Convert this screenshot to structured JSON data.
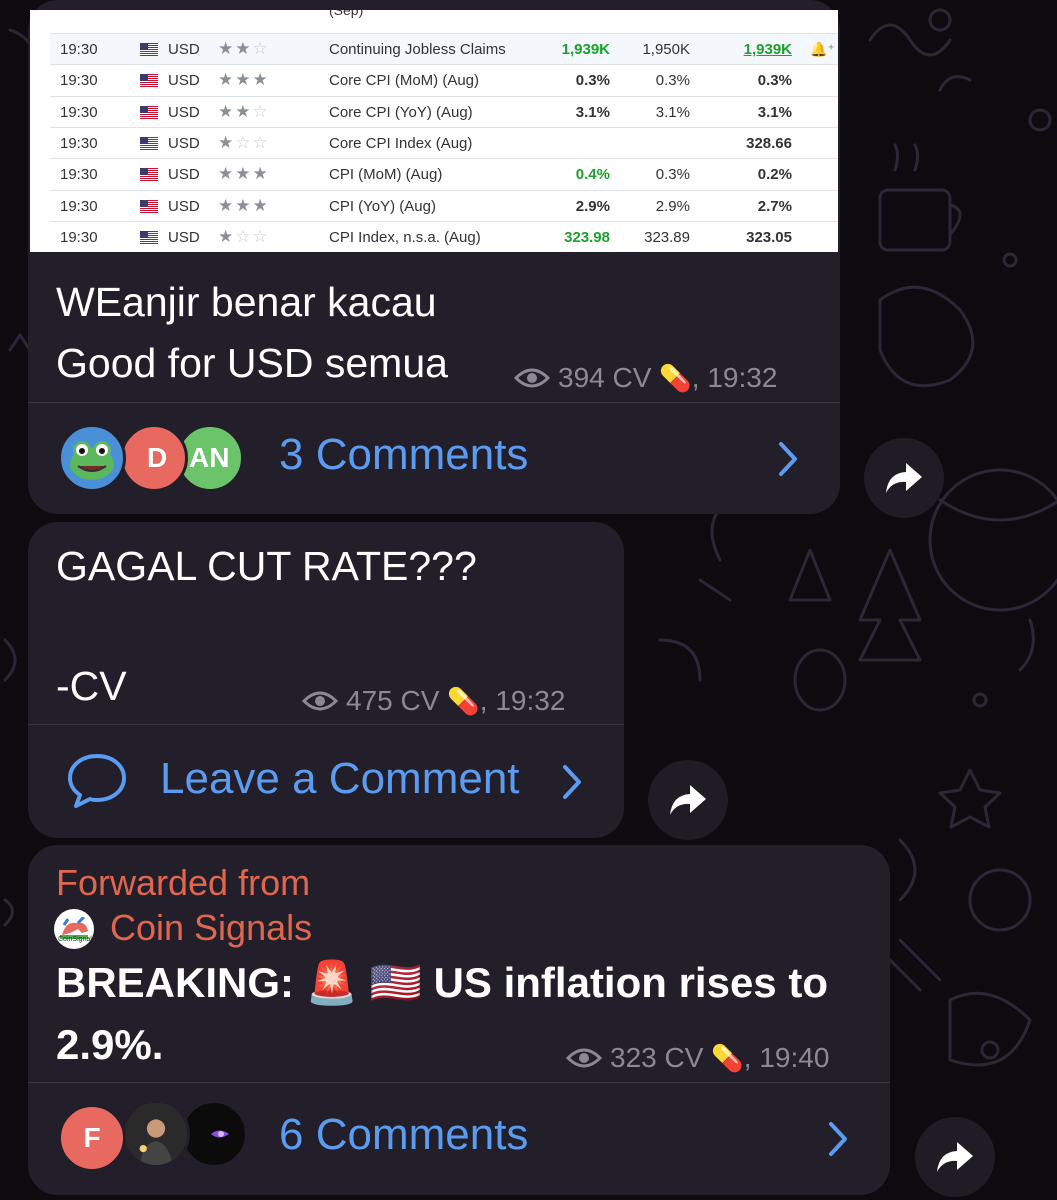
{
  "table": {
    "partial_top_text": "(Sep)",
    "rows": [
      {
        "time": "19:30",
        "currency": "USD",
        "stars": 2,
        "event": "Continuing Jobless Claims",
        "actual": "1,939K",
        "actual_color": "green",
        "forecast": "1,950K",
        "previous": "1,939K",
        "previous_color": "green",
        "highlight": true,
        "bell": "🔔⁺"
      },
      {
        "time": "19:30",
        "currency": "USD",
        "stars": 3,
        "event": "Core CPI (MoM) (Aug)",
        "actual": "0.3%",
        "actual_color": "black",
        "forecast": "0.3%",
        "previous": "0.3%",
        "previous_color": "black"
      },
      {
        "time": "19:30",
        "currency": "USD",
        "stars": 2,
        "event": "Core CPI (YoY) (Aug)",
        "actual": "3.1%",
        "actual_color": "black",
        "forecast": "3.1%",
        "previous": "3.1%",
        "previous_color": "black"
      },
      {
        "time": "19:30",
        "currency": "USD",
        "stars": 1,
        "event": "Core CPI Index (Aug)",
        "actual": "",
        "actual_color": "black",
        "forecast": "",
        "previous": "328.66",
        "previous_color": "black"
      },
      {
        "time": "19:30",
        "currency": "USD",
        "stars": 3,
        "event": "CPI (MoM) (Aug)",
        "actual": "0.4%",
        "actual_color": "green",
        "forecast": "0.3%",
        "previous": "0.2%",
        "previous_color": "black"
      },
      {
        "time": "19:30",
        "currency": "USD",
        "stars": 3,
        "event": "CPI (YoY) (Aug)",
        "actual": "2.9%",
        "actual_color": "black",
        "forecast": "2.9%",
        "previous": "2.7%",
        "previous_color": "black"
      },
      {
        "time": "19:30",
        "currency": "USD",
        "stars": 1,
        "event": "CPI Index, n.s.a. (Aug)",
        "actual": "323.98",
        "actual_color": "green",
        "forecast": "323.89",
        "previous": "323.05",
        "previous_color": "black"
      }
    ]
  },
  "messages": [
    {
      "line1": "WEanjir benar kacau",
      "line2": "Good for USD semua",
      "views": "394 CV",
      "pill": "💊",
      "time": ", 19:32",
      "comments_label": "3 Comments",
      "avatars": [
        {
          "initial": "",
          "color": "#4a90d9",
          "icon": "frog-icon"
        },
        {
          "initial": "D",
          "color": "#e8695f"
        },
        {
          "initial": "AN",
          "color": "#6bc46a"
        }
      ]
    },
    {
      "line1": "GAGAL CUT RATE???",
      "line2": "-CV",
      "views": "475 CV",
      "pill": "💊",
      "time": ", 19:32",
      "comments_label": "Leave a Comment"
    },
    {
      "forwarded_label": "Forwarded from",
      "source": "Coin Signals",
      "source_logo_text": "CoinSignals",
      "line1": "BREAKING: 🚨 🇺🇸 US inflation rises to",
      "line2": "2.9%.",
      "views": "323 CV",
      "pill": "💊",
      "time": ", 19:40",
      "comments_label": "6 Comments",
      "avatars": [
        {
          "initial": "F",
          "color": "#e8695f"
        },
        {
          "initial": "",
          "color": "#3a3a3a",
          "icon": "photo-avatar"
        },
        {
          "initial": "",
          "color": "#0b0b0b",
          "icon": "eye-avatar"
        }
      ]
    }
  ]
}
